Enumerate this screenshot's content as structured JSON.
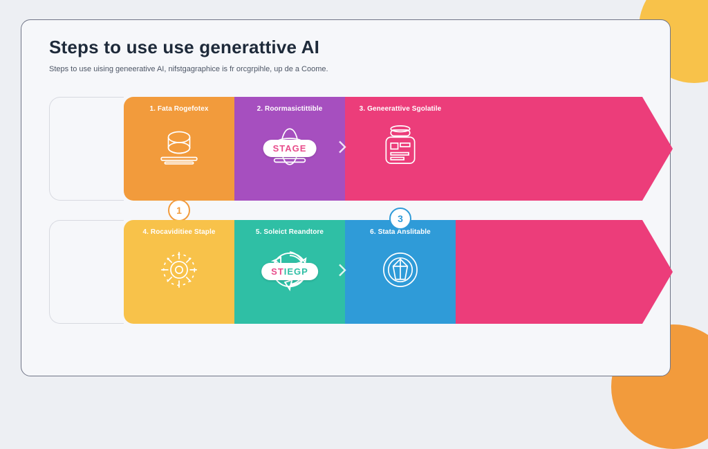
{
  "title": "Steps to use use generattive AI",
  "subtitle": "Steps to use uising geneerative AI, nifstgagraphice is fr orcgrpihle, up de a Coome.",
  "row1": {
    "badge": "STAGE",
    "tiles": [
      {
        "num": "1.",
        "label": "Fata Rogefotex"
      },
      {
        "num": "2.",
        "label": "Roormasictittible"
      },
      {
        "num": "3.",
        "label": "Geneerattive Sgolatile"
      }
    ],
    "circleBelow": "1"
  },
  "row2": {
    "badge": "STIEGP",
    "tiles": [
      {
        "num": "4.",
        "label": "Rocaviditiee Staple"
      },
      {
        "num": "5.",
        "label": "Soleict Reandtore"
      },
      {
        "num": "6.",
        "label": "Stata Anslitable"
      }
    ],
    "circleAbove": "3"
  },
  "colors": {
    "orange": "#F29B3C",
    "purple": "#A64FBF",
    "pink": "#EC3D7A",
    "yellow": "#F8C24A",
    "teal": "#2FBFA5",
    "blue": "#2F9BD8"
  }
}
